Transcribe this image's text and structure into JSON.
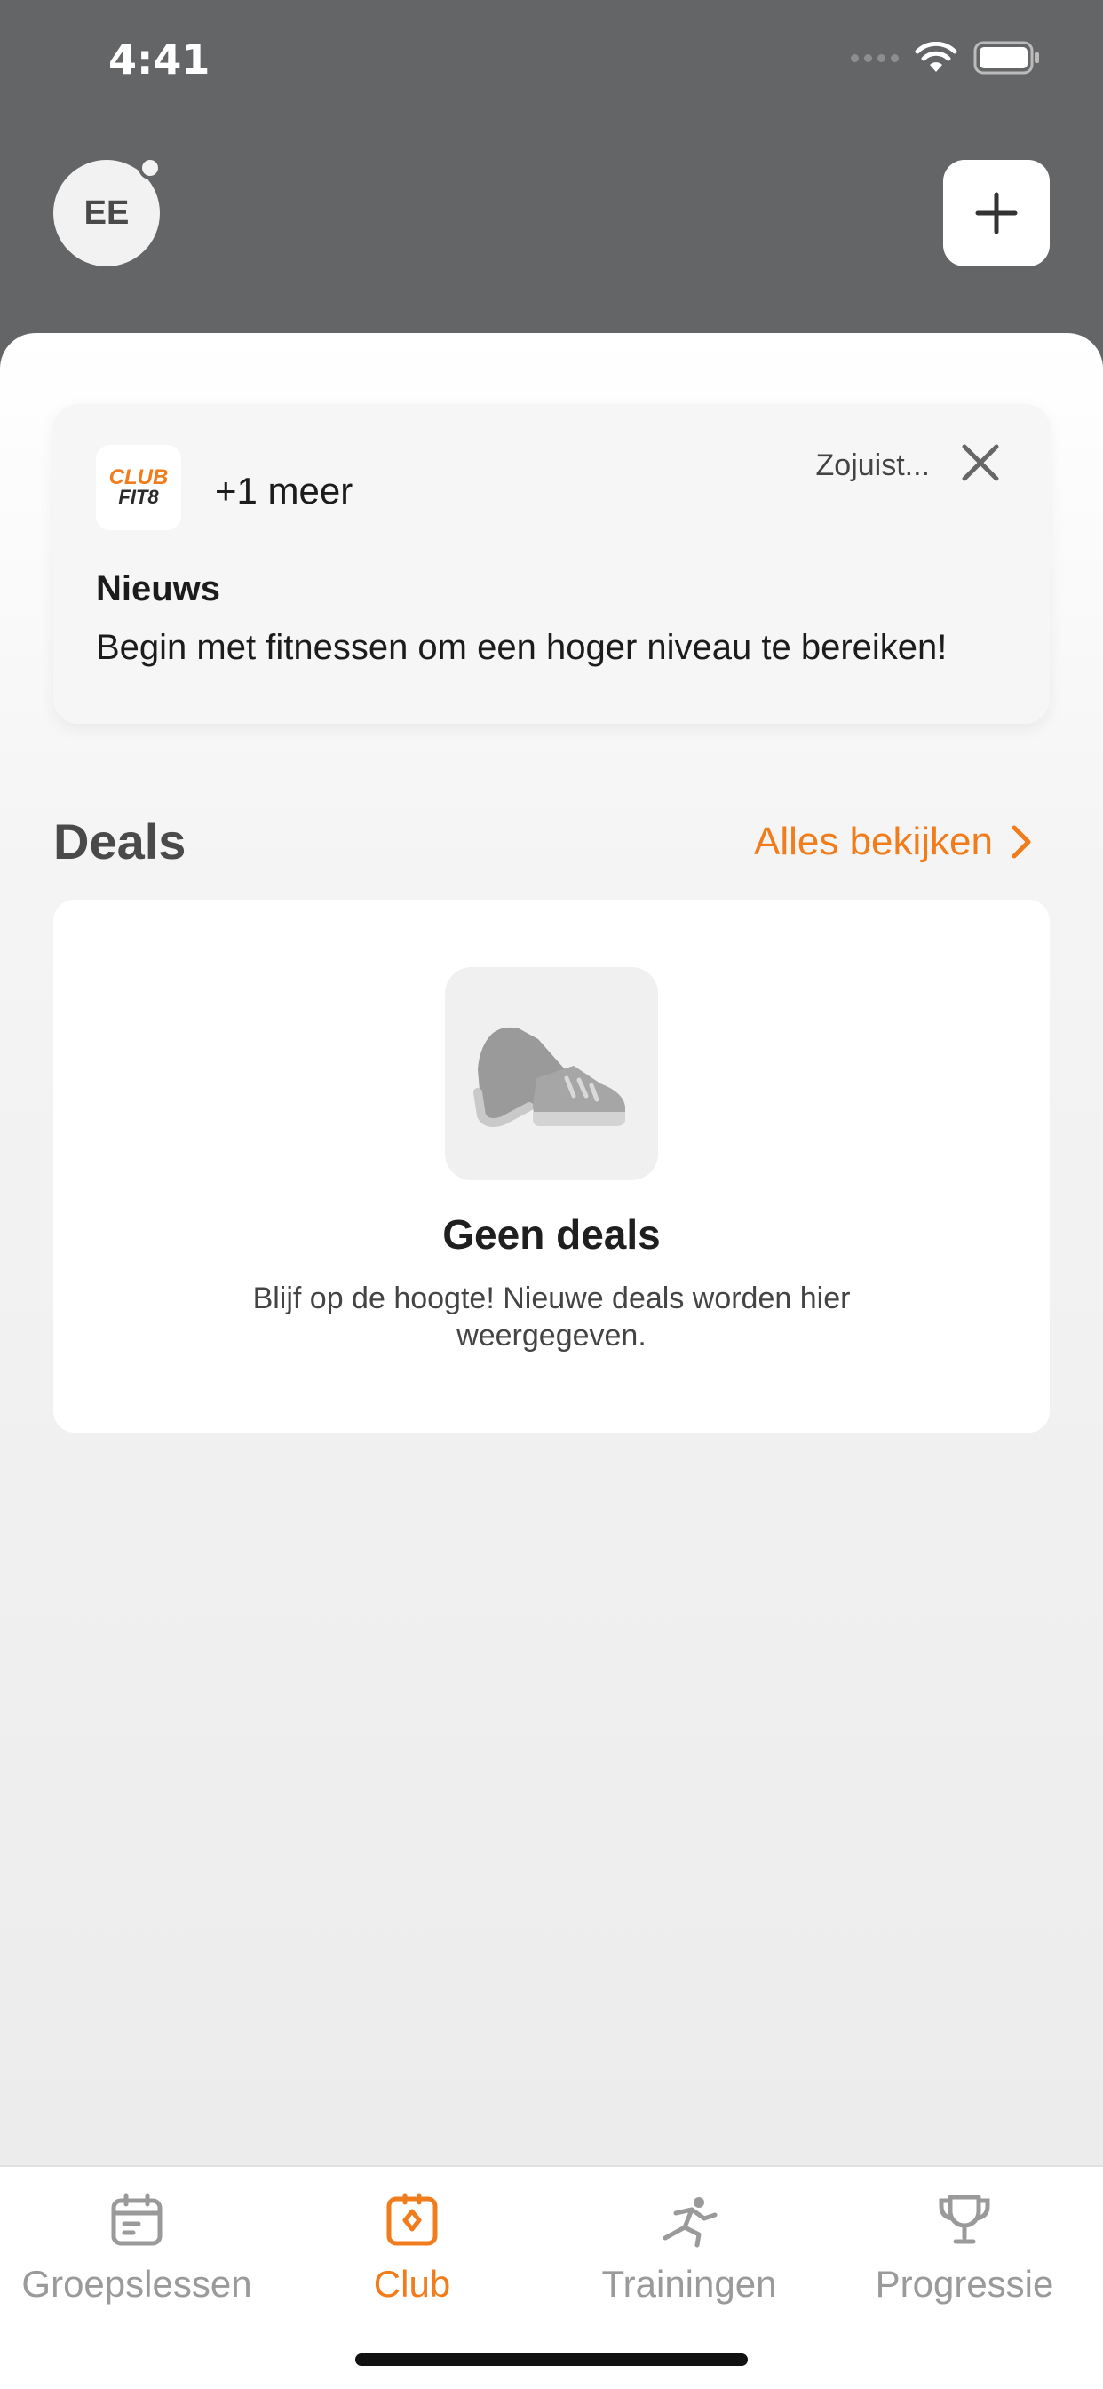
{
  "status_bar": {
    "time": "4:41"
  },
  "header": {
    "avatar_initials": "EE"
  },
  "notification": {
    "logo_line1": "CLUB",
    "logo_line2": "FIT8",
    "more_label": "+1 meer",
    "time_label": "Zojuist...",
    "title": "Nieuws",
    "body": "Begin met fitnessen om een hoger niveau te bereiken!"
  },
  "deals": {
    "section_title": "Deals",
    "see_all_label": "Alles bekijken",
    "empty_title": "Geen deals",
    "empty_description": "Blijf op de hoogte! Nieuwe deals worden hier weergegeven."
  },
  "tabs": [
    {
      "label": "Groepslessen",
      "icon": "calendar-icon",
      "active": false
    },
    {
      "label": "Club",
      "icon": "club-icon",
      "active": true
    },
    {
      "label": "Trainingen",
      "icon": "runner-icon",
      "active": false
    },
    {
      "label": "Progressie",
      "icon": "trophy-icon",
      "active": false
    }
  ],
  "colors": {
    "accent": "#f07c1b",
    "header_bg": "#646567",
    "inactive": "#9a9a9a"
  }
}
